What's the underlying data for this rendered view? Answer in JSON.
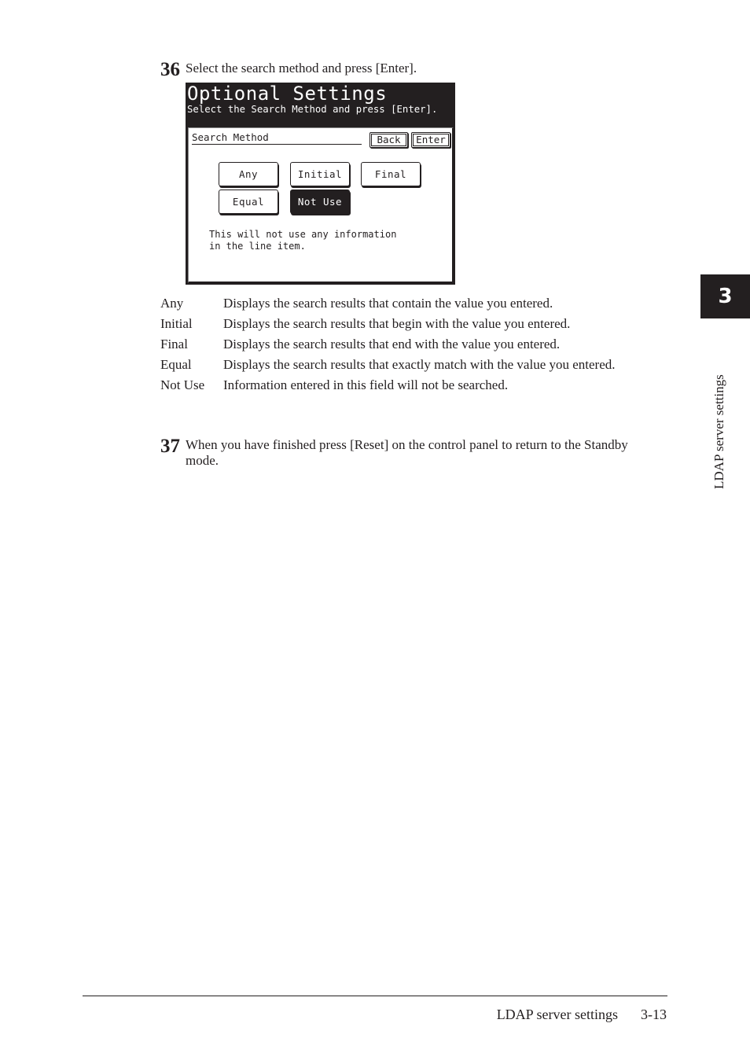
{
  "steps": [
    {
      "number": "36",
      "text": "Select the search method and press [Enter]."
    },
    {
      "number": "37",
      "text": "When you have finished press [Reset] on the control panel to return to the Standby mode."
    }
  ],
  "screen": {
    "title": "Optional Settings",
    "subtitle": "Select the Search Method and press [Enter].",
    "field_label": "Search Method",
    "buttons": {
      "back": "Back",
      "enter": "Enter"
    },
    "options": [
      {
        "label": "Any",
        "selected": false
      },
      {
        "label": "Initial",
        "selected": false
      },
      {
        "label": "Final",
        "selected": false
      },
      {
        "label": "Equal",
        "selected": false
      },
      {
        "label": "Not Use",
        "selected": true
      }
    ],
    "info_text": "This will not use any information\nin the line item."
  },
  "definitions": [
    {
      "term": "Any",
      "description": "Displays the search results that contain the value you entered."
    },
    {
      "term": "Initial",
      "description": "Displays the search results that begin with the value you entered."
    },
    {
      "term": "Final",
      "description": "Displays the search results that end with the value you entered."
    },
    {
      "term": "Equal",
      "description": "Displays the search results that exactly match with the value you entered."
    },
    {
      "term": "Not Use",
      "description": "Information entered in this field will not be searched."
    }
  ],
  "chapter": {
    "number": "3",
    "side_label": "LDAP server settings"
  },
  "footer": {
    "section_title": "LDAP server settings",
    "page_number": "3-13"
  }
}
